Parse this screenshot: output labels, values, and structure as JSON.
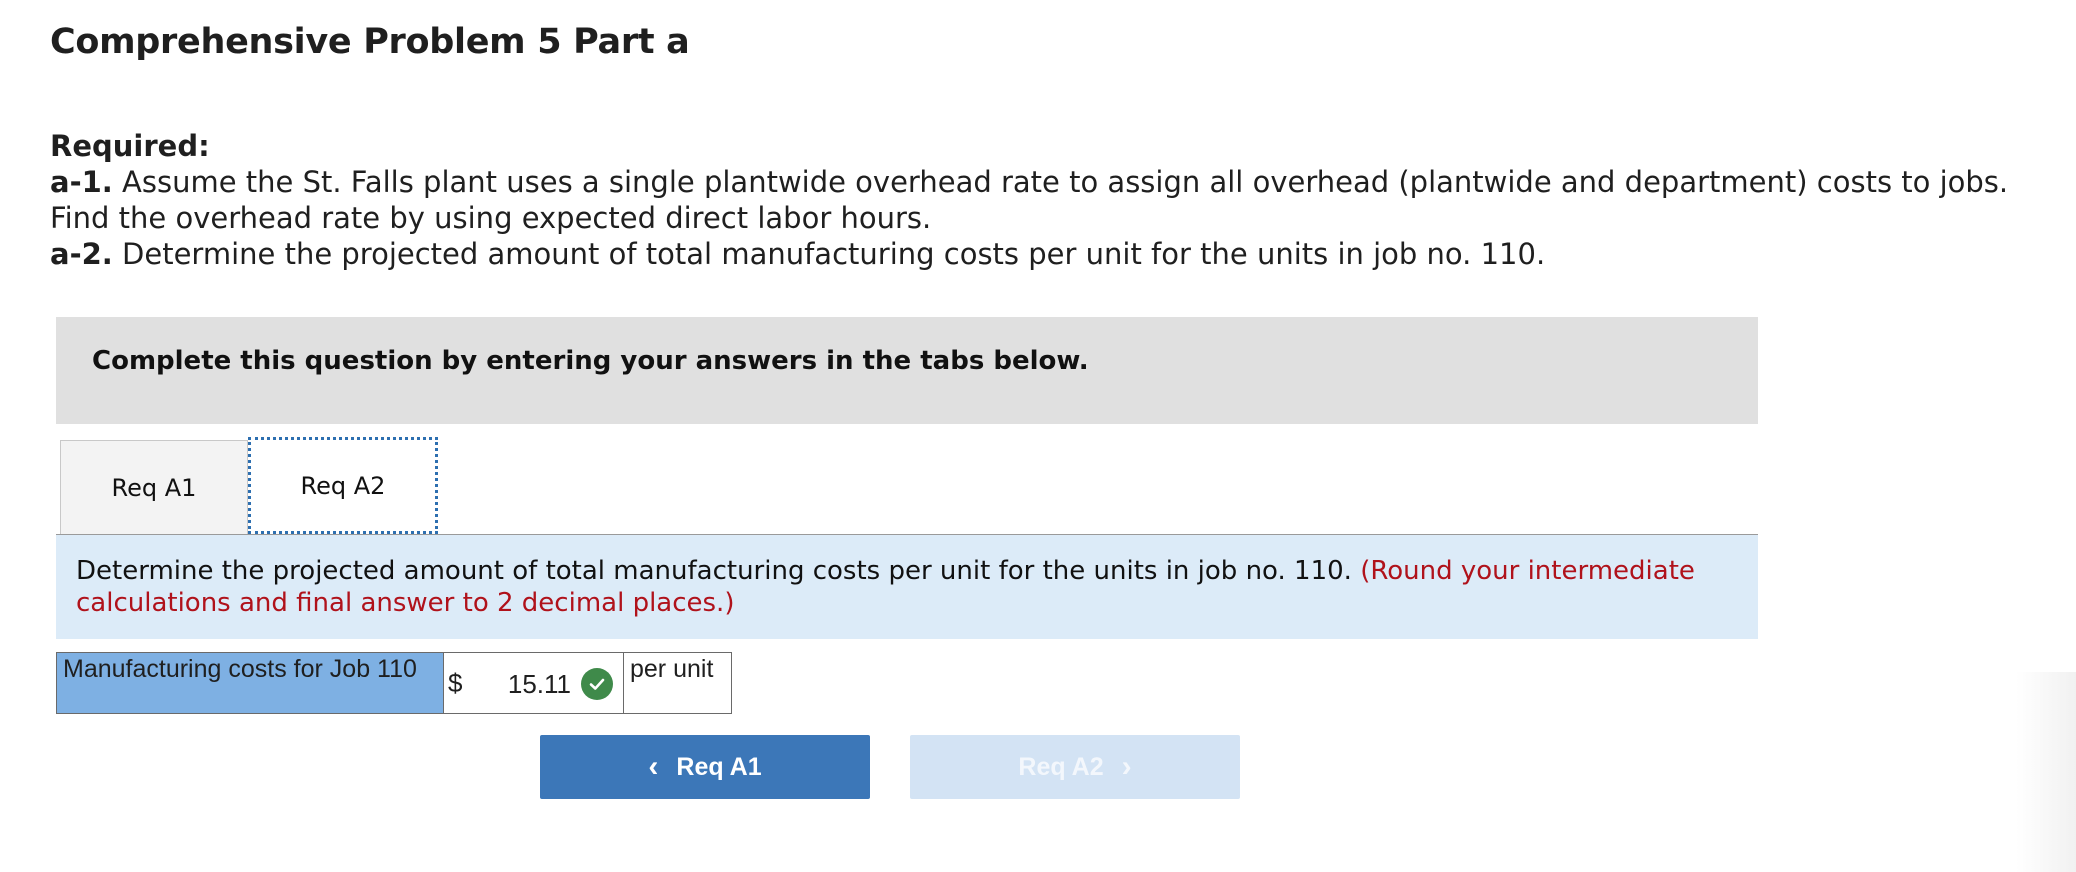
{
  "page": {
    "title": "Comprehensive Problem 5 Part a"
  },
  "required": {
    "heading": "Required:",
    "items": [
      {
        "label": "a-1.",
        "text": " Assume the St. Falls plant uses a single plantwide overhead rate to assign all overhead (plantwide and department) costs to jobs. Find the overhead rate by using expected direct labor hours."
      },
      {
        "label": "a-2.",
        "text": " Determine the projected amount of total manufacturing costs per unit for the units in job no. 110."
      }
    ]
  },
  "instruction": "Complete this question by entering your answers in the tabs below.",
  "tabs": [
    {
      "label": "Req A1",
      "active": false
    },
    {
      "label": "Req A2",
      "active": true
    }
  ],
  "question": {
    "text": "Determine the projected amount of total manufacturing costs per unit for the units in job no. 110. ",
    "note": "(Round your intermediate calculations and final answer to 2 decimal places.)"
  },
  "answer": {
    "label": "Manufacturing costs for Job 110",
    "currency": "$",
    "value": "15.11",
    "status": "correct",
    "unit": "per unit",
    "icon": "check-circle-icon"
  },
  "navigation": {
    "prev_label": "Req A1",
    "next_label": "Req A2",
    "next_enabled": false
  },
  "colors": {
    "accent": "#3c77b8",
    "note_red": "#b0121b",
    "correct_green": "#3f8a4a",
    "label_cell_blue": "#7eb0e3",
    "panel_blue": "#dcebf8"
  }
}
